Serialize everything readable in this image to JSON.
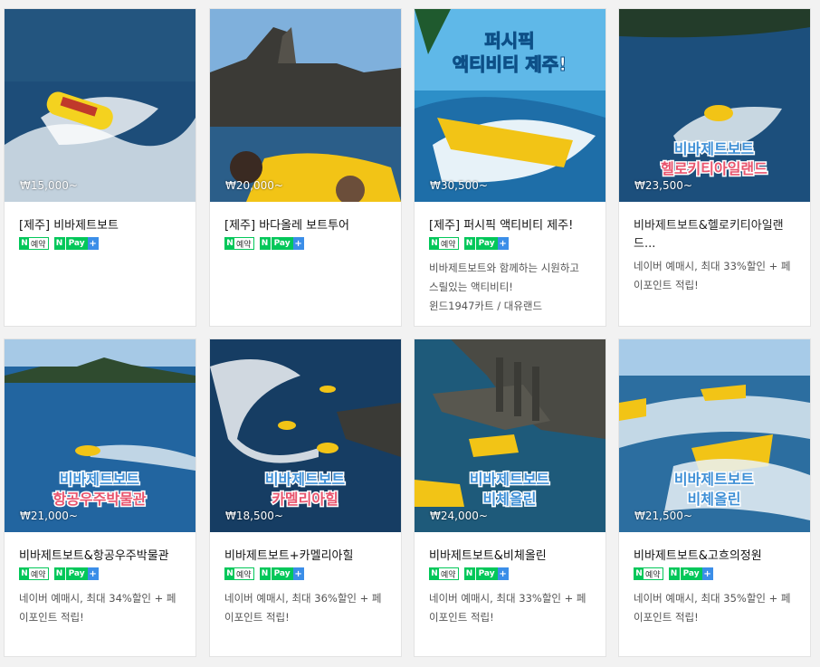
{
  "products": [
    {
      "title": "[제주] 비바제트보트",
      "price": "₩15,000~",
      "desc": []
    },
    {
      "title": "[제주] 바다올레 보트투어",
      "price": "₩20,000~",
      "desc": []
    },
    {
      "title": "[제주] 퍼시픽 액티비티 제주!",
      "price": "₩30,500~",
      "desc": [
        "비바제트보트와 함께하는 시원하고",
        "스릴있는 액티비티!",
        "윈드1947카트 / 대유랜드"
      ],
      "overlay_title": [
        "퍼시픽",
        "액티비티 제주!"
      ]
    },
    {
      "title": "비바제트보트&헬로키티아일랜드…",
      "title_lines": [
        "비바제트보트&헬로키티아일랜",
        "드..."
      ],
      "price": "₩23,500~",
      "desc": [
        "네이버 예매시, 최대 33%할인 + 페",
        "이포인트 적립!"
      ],
      "overlay": [
        "비바제트보트",
        "헬로키티아일랜드"
      ]
    },
    {
      "title": "비바제트보트&항공우주박물관",
      "price": "₩21,000~",
      "desc": [
        "네이버 예매시, 최대 34%할인 + 페",
        "이포인트 적립!"
      ],
      "overlay": [
        "비바제트보트",
        "항공우주박물관"
      ]
    },
    {
      "title": "비바제트보트+카멜리아힐",
      "price": "₩18,500~",
      "desc": [
        "네이버 예매시, 최대 36%할인 + 페",
        "이포인트 적립!"
      ],
      "overlay": [
        "비바제트보트",
        "카멜리아힐"
      ]
    },
    {
      "title": "비바제트보트&비체올린",
      "price": "₩24,000~",
      "desc": [
        "네이버 예매시, 최대 33%할인 + 페",
        "이포인트 적립!"
      ],
      "overlay": [
        "비바제트보트",
        "비체올린"
      ]
    },
    {
      "title": "비바제트보트&고흐의정원",
      "price": "₩21,500~",
      "desc": [
        "네이버 예매시, 최대 35%할인 + 페",
        "이포인트 적립!"
      ],
      "overlay": [
        "비바제트보트",
        "비체올린"
      ]
    }
  ],
  "badges": {
    "reserve_n": "N",
    "reserve_label": "예약",
    "pay_n": "N",
    "pay_label": "Pay",
    "pay_plus": "+"
  },
  "colors": {
    "naver_green": "#03c75a",
    "pay_blue": "#3b8ee8",
    "sea": "#1f4f7a",
    "overlay_pink": "#e8546d",
    "overlay_blue": "#3e8fd6"
  }
}
